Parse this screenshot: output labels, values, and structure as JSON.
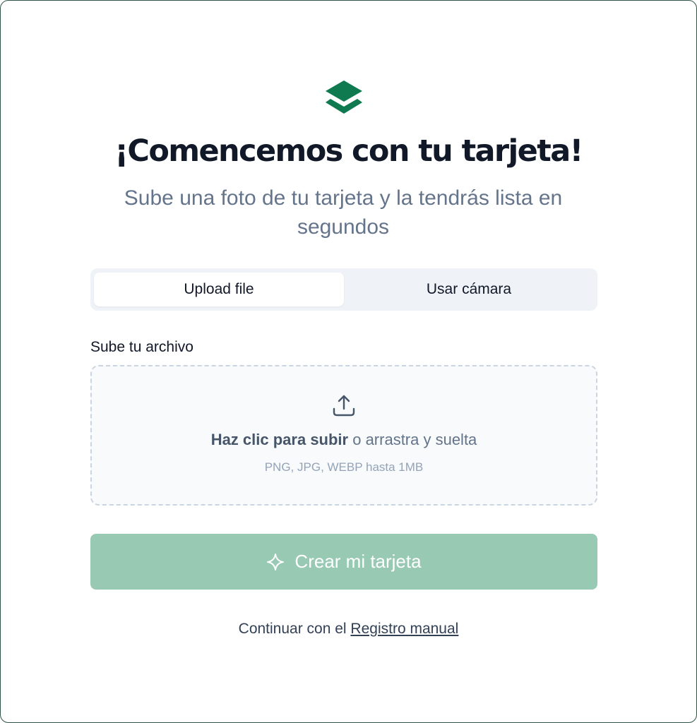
{
  "header": {
    "logo_icon": "layers-icon",
    "title": "¡Comencemos con tu tarjeta!",
    "subtitle": "Sube una foto de tu tarjeta y la tendrás lista en segundos"
  },
  "tabs": [
    {
      "label": "Upload file",
      "selected": true
    },
    {
      "label": "Usar cámara",
      "selected": false
    }
  ],
  "upload": {
    "label": "Sube tu archivo",
    "icon": "upload-icon",
    "click_text": "Haz clic para subir",
    "drag_text": " o arrastra y suelta",
    "hint": "PNG, JPG, WEBP hasta 1MB"
  },
  "create_button": {
    "icon": "sparkle-icon",
    "label": "Crear mi tarjeta",
    "disabled": true
  },
  "footer": {
    "prefix": "Continuar con el ",
    "link": "Registro manual"
  },
  "colors": {
    "brand": "#0f7a4f",
    "button_disabled": "#98c9b3",
    "text_dark": "#111827",
    "text_muted": "#64748b"
  }
}
